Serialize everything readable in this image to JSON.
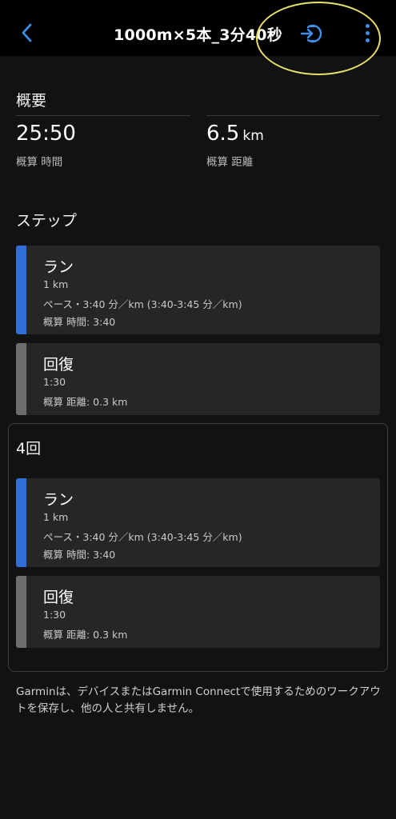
{
  "header": {
    "title": "1000m×5本_3分40秒",
    "back_icon": "chevron-left-icon",
    "send_icon": "send-to-device-icon",
    "more_icon": "more-vertical-icon",
    "accent_color": "#3f8ee8",
    "highlight_color": "#e9e16a"
  },
  "overview": {
    "title": "概要",
    "time_value": "25:50",
    "time_label": "概算 時間",
    "distance_value": "6.5",
    "distance_unit": "km",
    "distance_label": "概算 距離"
  },
  "steps": {
    "title": "ステップ",
    "items": [
      {
        "type": "run",
        "title": "ラン",
        "line1": "1 km",
        "line2": "ペース・3:40 分／km (3:40-3:45 分／km)",
        "line3": "概算 時間: 3:40"
      },
      {
        "type": "recovery",
        "title": "回復",
        "line1": "1:30",
        "line2": "概算 距離: 0.3 km"
      }
    ]
  },
  "repeat": {
    "label": "4回",
    "items": [
      {
        "type": "run",
        "title": "ラン",
        "line1": "1 km",
        "line2": "ペース・3:40 分／km (3:40-3:45 分／km)",
        "line3": "概算 時間: 3:40"
      },
      {
        "type": "recovery",
        "title": "回復",
        "line1": "1:30",
        "line2": "概算 距離: 0.3 km"
      }
    ]
  },
  "footer": {
    "note": "Garminは、デバイスまたはGarmin Connectで使用するためのワークアウトを保存し、他の人と共有しません。"
  }
}
